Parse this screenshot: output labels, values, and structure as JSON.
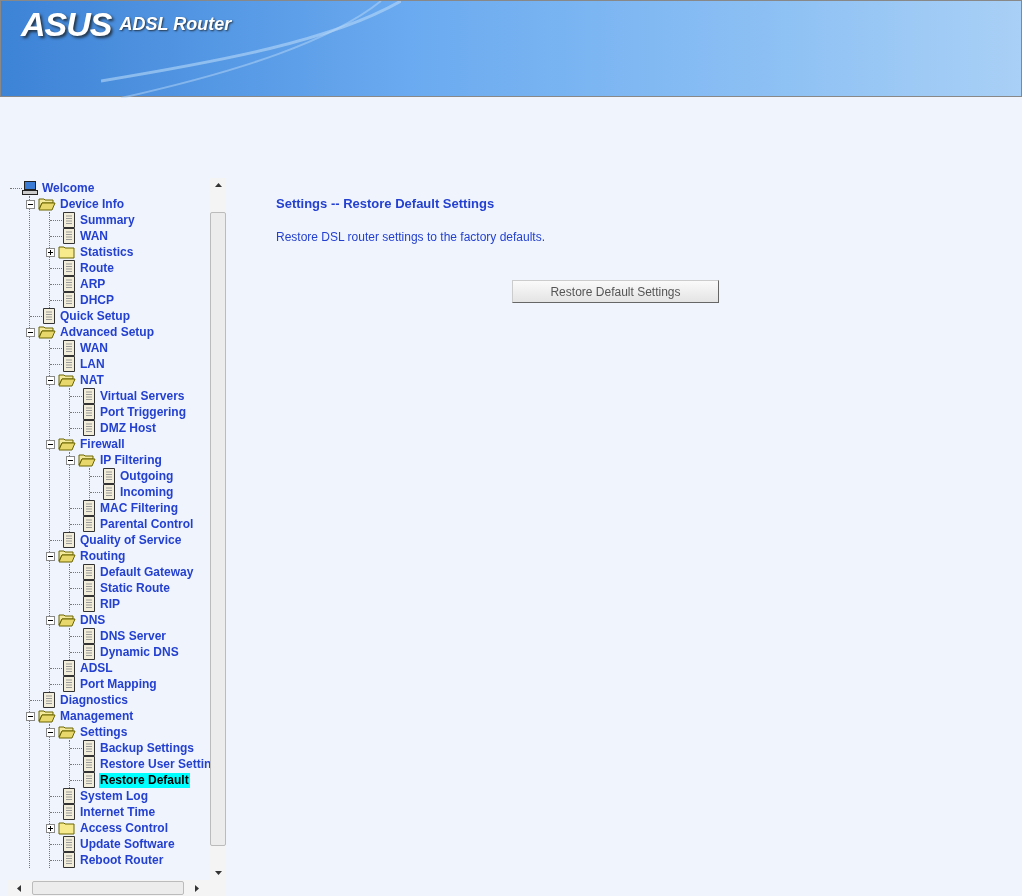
{
  "header": {
    "logo": "ASUS",
    "product": "ADSL Router"
  },
  "tree": [
    {
      "label": "Welcome",
      "kind": "computer",
      "selected": false,
      "children": [
        {
          "label": "Device Info",
          "kind": "folder",
          "expanded": true,
          "selected": false,
          "children": [
            {
              "label": "Summary",
              "kind": "page",
              "selected": false
            },
            {
              "label": "WAN",
              "kind": "page",
              "selected": false
            },
            {
              "label": "Statistics",
              "kind": "folder",
              "expanded": false,
              "selected": false
            },
            {
              "label": "Route",
              "kind": "page",
              "selected": false
            },
            {
              "label": "ARP",
              "kind": "page",
              "selected": false
            },
            {
              "label": "DHCP",
              "kind": "page",
              "selected": false
            }
          ]
        },
        {
          "label": "Quick Setup",
          "kind": "page",
          "selected": false
        },
        {
          "label": "Advanced Setup",
          "kind": "folder",
          "expanded": true,
          "selected": false,
          "children": [
            {
              "label": "WAN",
              "kind": "page",
              "selected": false
            },
            {
              "label": "LAN",
              "kind": "page",
              "selected": false
            },
            {
              "label": "NAT",
              "kind": "folder",
              "expanded": true,
              "selected": false,
              "children": [
                {
                  "label": "Virtual Servers",
                  "kind": "page",
                  "selected": false
                },
                {
                  "label": "Port Triggering",
                  "kind": "page",
                  "selected": false
                },
                {
                  "label": "DMZ Host",
                  "kind": "page",
                  "selected": false
                }
              ]
            },
            {
              "label": "Firewall",
              "kind": "folder",
              "expanded": true,
              "selected": false,
              "children": [
                {
                  "label": "IP Filtering",
                  "kind": "folder",
                  "expanded": true,
                  "selected": false,
                  "children": [
                    {
                      "label": "Outgoing",
                      "kind": "page",
                      "selected": false
                    },
                    {
                      "label": "Incoming",
                      "kind": "page",
                      "selected": false
                    }
                  ]
                },
                {
                  "label": "MAC Filtering",
                  "kind": "page",
                  "selected": false
                },
                {
                  "label": "Parental Control",
                  "kind": "page",
                  "selected": false
                }
              ]
            },
            {
              "label": "Quality of Service",
              "kind": "page",
              "selected": false
            },
            {
              "label": "Routing",
              "kind": "folder",
              "expanded": true,
              "selected": false,
              "children": [
                {
                  "label": "Default Gateway",
                  "kind": "page",
                  "selected": false
                },
                {
                  "label": "Static Route",
                  "kind": "page",
                  "selected": false
                },
                {
                  "label": "RIP",
                  "kind": "page",
                  "selected": false
                }
              ]
            },
            {
              "label": "DNS",
              "kind": "folder",
              "expanded": true,
              "selected": false,
              "children": [
                {
                  "label": "DNS Server",
                  "kind": "page",
                  "selected": false
                },
                {
                  "label": "Dynamic DNS",
                  "kind": "page",
                  "selected": false
                }
              ]
            },
            {
              "label": "ADSL",
              "kind": "page",
              "selected": false
            },
            {
              "label": "Port Mapping",
              "kind": "page",
              "selected": false
            }
          ]
        },
        {
          "label": "Diagnostics",
          "kind": "page",
          "selected": false
        },
        {
          "label": "Management",
          "kind": "folder",
          "expanded": true,
          "selected": false,
          "children": [
            {
              "label": "Settings",
              "kind": "folder",
              "expanded": true,
              "selected": false,
              "children": [
                {
                  "label": "Backup Settings",
                  "kind": "page",
                  "selected": false
                },
                {
                  "label": "Restore User Settin",
                  "kind": "page",
                  "selected": false
                },
                {
                  "label": "Restore Default",
                  "kind": "page",
                  "selected": true
                }
              ]
            },
            {
              "label": "System Log",
              "kind": "page",
              "selected": false
            },
            {
              "label": "Internet Time",
              "kind": "page",
              "selected": false
            },
            {
              "label": "Access Control",
              "kind": "folder",
              "expanded": false,
              "selected": false
            },
            {
              "label": "Update Software",
              "kind": "page",
              "selected": false
            },
            {
              "label": "Reboot Router",
              "kind": "page",
              "selected": false
            }
          ]
        }
      ]
    }
  ],
  "content": {
    "title": "Settings -- Restore Default Settings",
    "description": "Restore DSL router settings to the factory defaults.",
    "button": "Restore Default Settings"
  }
}
